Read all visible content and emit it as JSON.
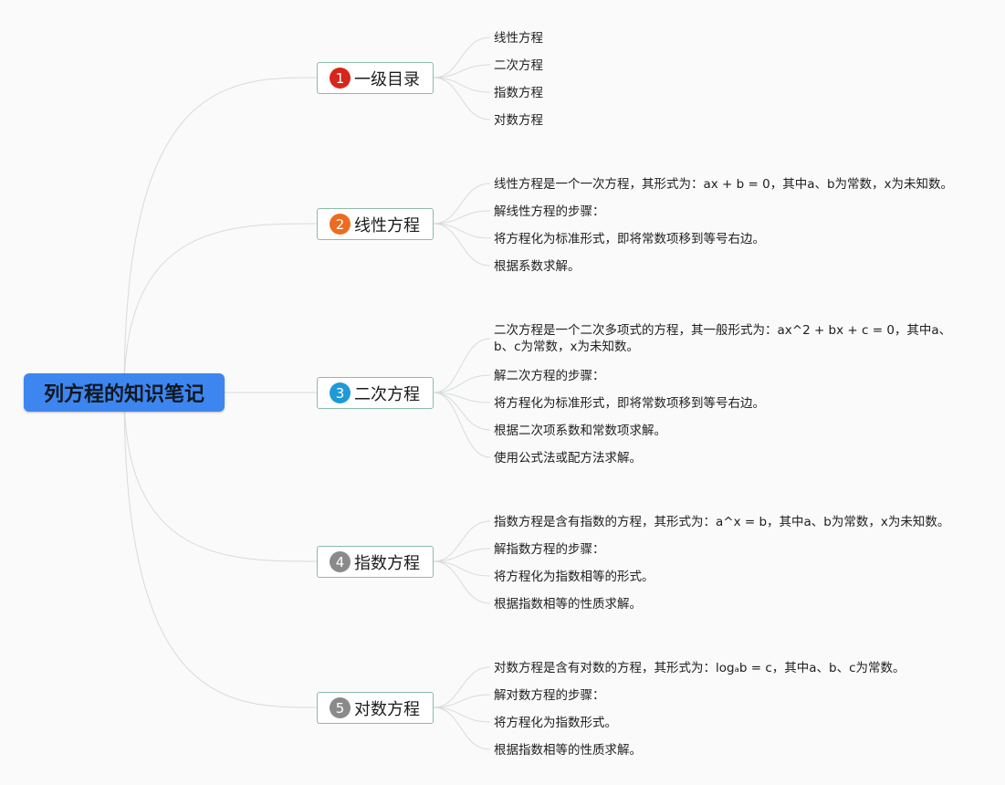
{
  "root": {
    "label": "列方程的知识笔记"
  },
  "colors": {
    "root_bg": "#3d86f0",
    "branch_border": "#8cbca8",
    "link": "#d6dcd9"
  },
  "branches": [
    {
      "number": "1",
      "label": "一级目录",
      "badge_color": "#d7261b",
      "leaves": [
        "线性方程",
        "二次方程",
        "指数方程",
        "对数方程"
      ]
    },
    {
      "number": "2",
      "label": "线性方程",
      "badge_color": "#eb6d1f",
      "leaves": [
        "线性方程是一个一次方程，其形式为：ax + b = 0，其中a、b为常数，x为未知数。",
        "解线性方程的步骤：",
        "将方程化为标准形式，即将常数项移到等号右边。",
        "根据系数求解。"
      ]
    },
    {
      "number": "3",
      "label": "二次方程",
      "badge_color": "#1f9ad6",
      "leaves": [
        "二次方程是一个二次多项式的方程，其一般形式为：ax^2 + bx + c = 0，其中a、b、c为常数，x为未知数。",
        "解二次方程的步骤：",
        "将方程化为标准形式，即将常数项移到等号右边。",
        "根据二次项系数和常数项求解。",
        "使用公式法或配方法求解。"
      ]
    },
    {
      "number": "4",
      "label": "指数方程",
      "badge_color": "#8a8a8a",
      "leaves": [
        "指数方程是含有指数的方程，其形式为：a^x = b，其中a、b为常数，x为未知数。",
        "解指数方程的步骤：",
        "将方程化为指数相等的形式。",
        "根据指数相等的性质求解。"
      ]
    },
    {
      "number": "5",
      "label": "对数方程",
      "badge_color": "#8a8a8a",
      "leaves": [
        "对数方程是含有对数的方程，其形式为：logₐb = c，其中a、b、c为常数。",
        "解对数方程的步骤：",
        "将方程化为指数形式。",
        "根据指数相等的性质求解。"
      ]
    }
  ]
}
